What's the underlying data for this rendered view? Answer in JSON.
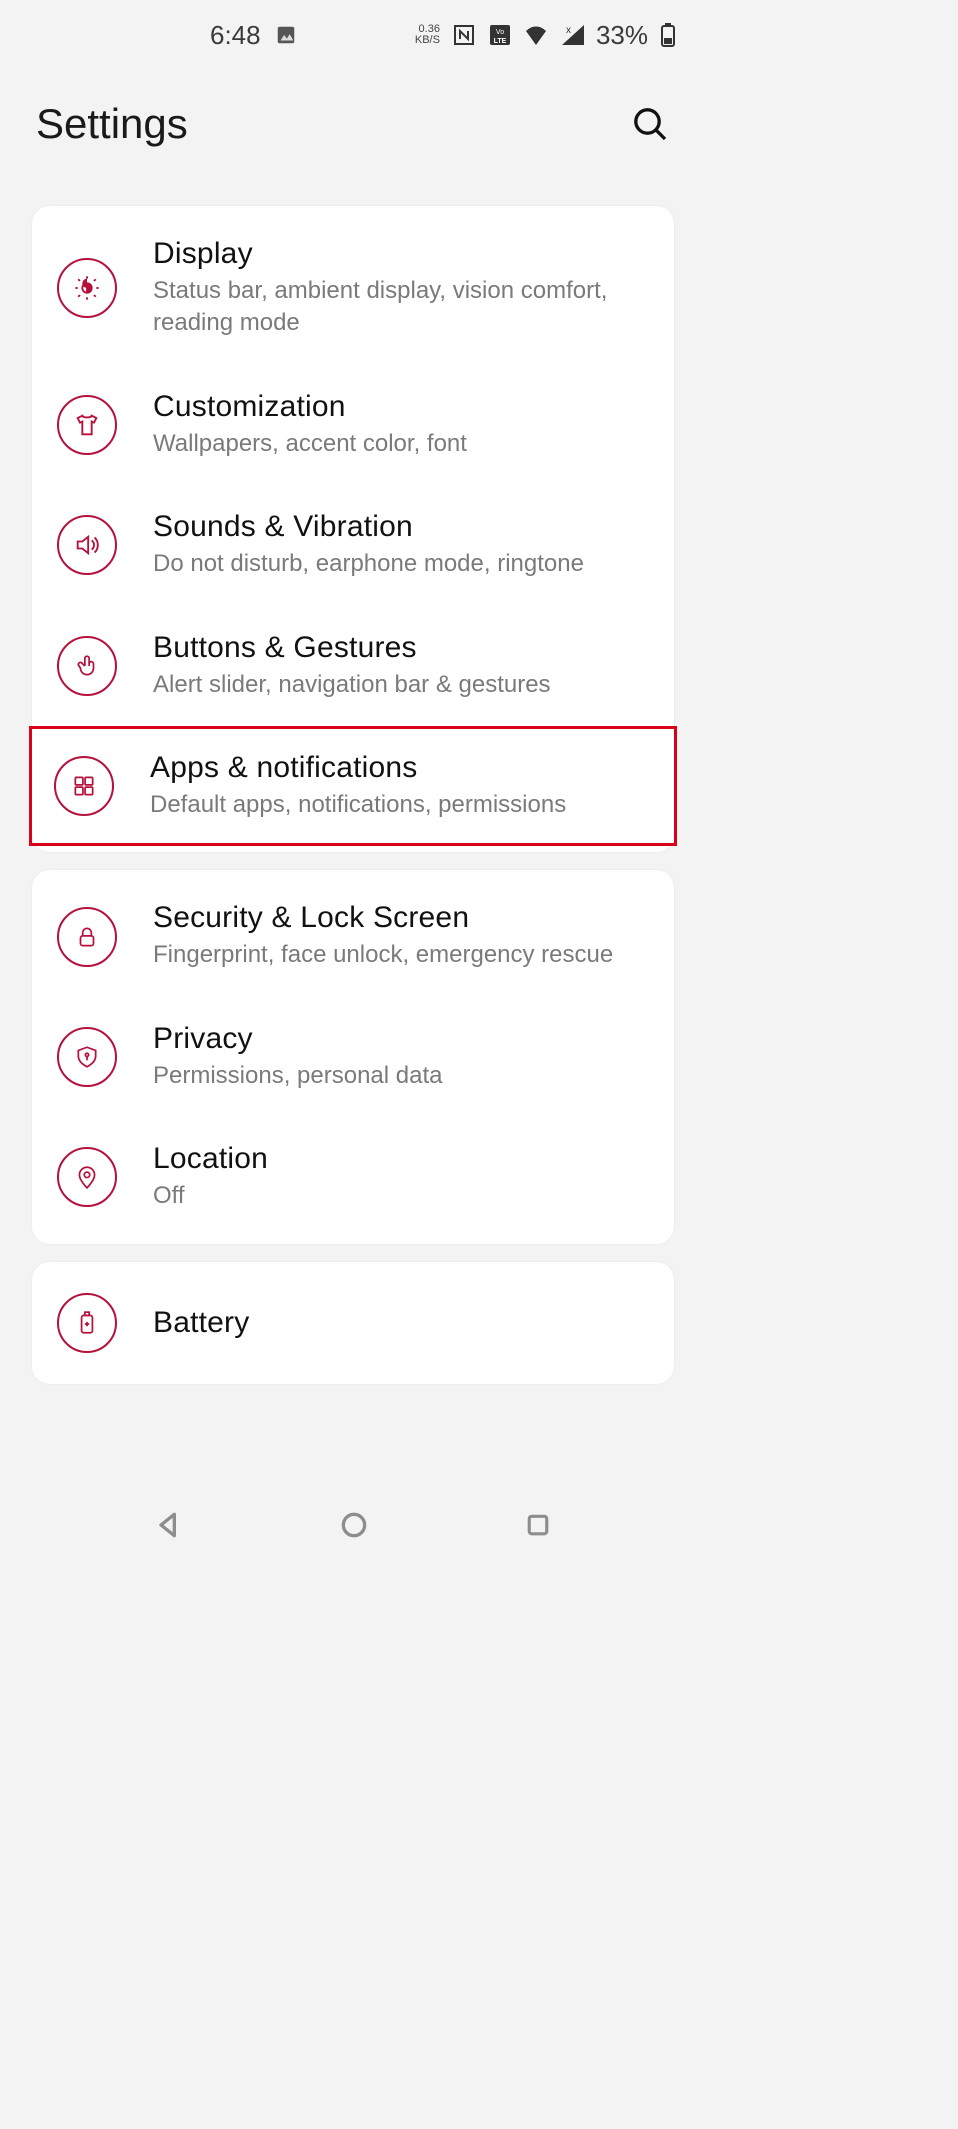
{
  "statusbar": {
    "time": "6:48",
    "kbps_top": "0.36",
    "kbps_bottom": "KB/S",
    "battery_pct": "33%"
  },
  "header": {
    "title": "Settings"
  },
  "group1": [
    {
      "icon": "brightness",
      "title": "Display",
      "sub": "Status bar, ambient display, vision comfort, reading mode",
      "name": "settings-display",
      "highlight": false
    },
    {
      "icon": "tshirt",
      "title": "Customization",
      "sub": "Wallpapers, accent color, font",
      "name": "settings-customization",
      "highlight": false
    },
    {
      "icon": "volume",
      "title": "Sounds & Vibration",
      "sub": "Do not disturb, earphone mode, ringtone",
      "name": "settings-sounds",
      "highlight": false
    },
    {
      "icon": "gesture",
      "title": "Buttons & Gestures",
      "sub": "Alert slider, navigation bar & gestures",
      "name": "settings-buttons",
      "highlight": false
    },
    {
      "icon": "apps",
      "title": "Apps & notifications",
      "sub": "Default apps, notifications, permissions",
      "name": "settings-apps",
      "highlight": true
    }
  ],
  "group2": [
    {
      "icon": "lock",
      "title": "Security & Lock Screen",
      "sub": "Fingerprint, face unlock, emergency rescue",
      "name": "settings-security"
    },
    {
      "icon": "shield",
      "title": "Privacy",
      "sub": "Permissions, personal data",
      "name": "settings-privacy"
    },
    {
      "icon": "location",
      "title": "Location",
      "sub": "Off",
      "name": "settings-location"
    }
  ],
  "group3": [
    {
      "icon": "battery",
      "title": "Battery",
      "sub": "",
      "name": "settings-battery"
    }
  ]
}
